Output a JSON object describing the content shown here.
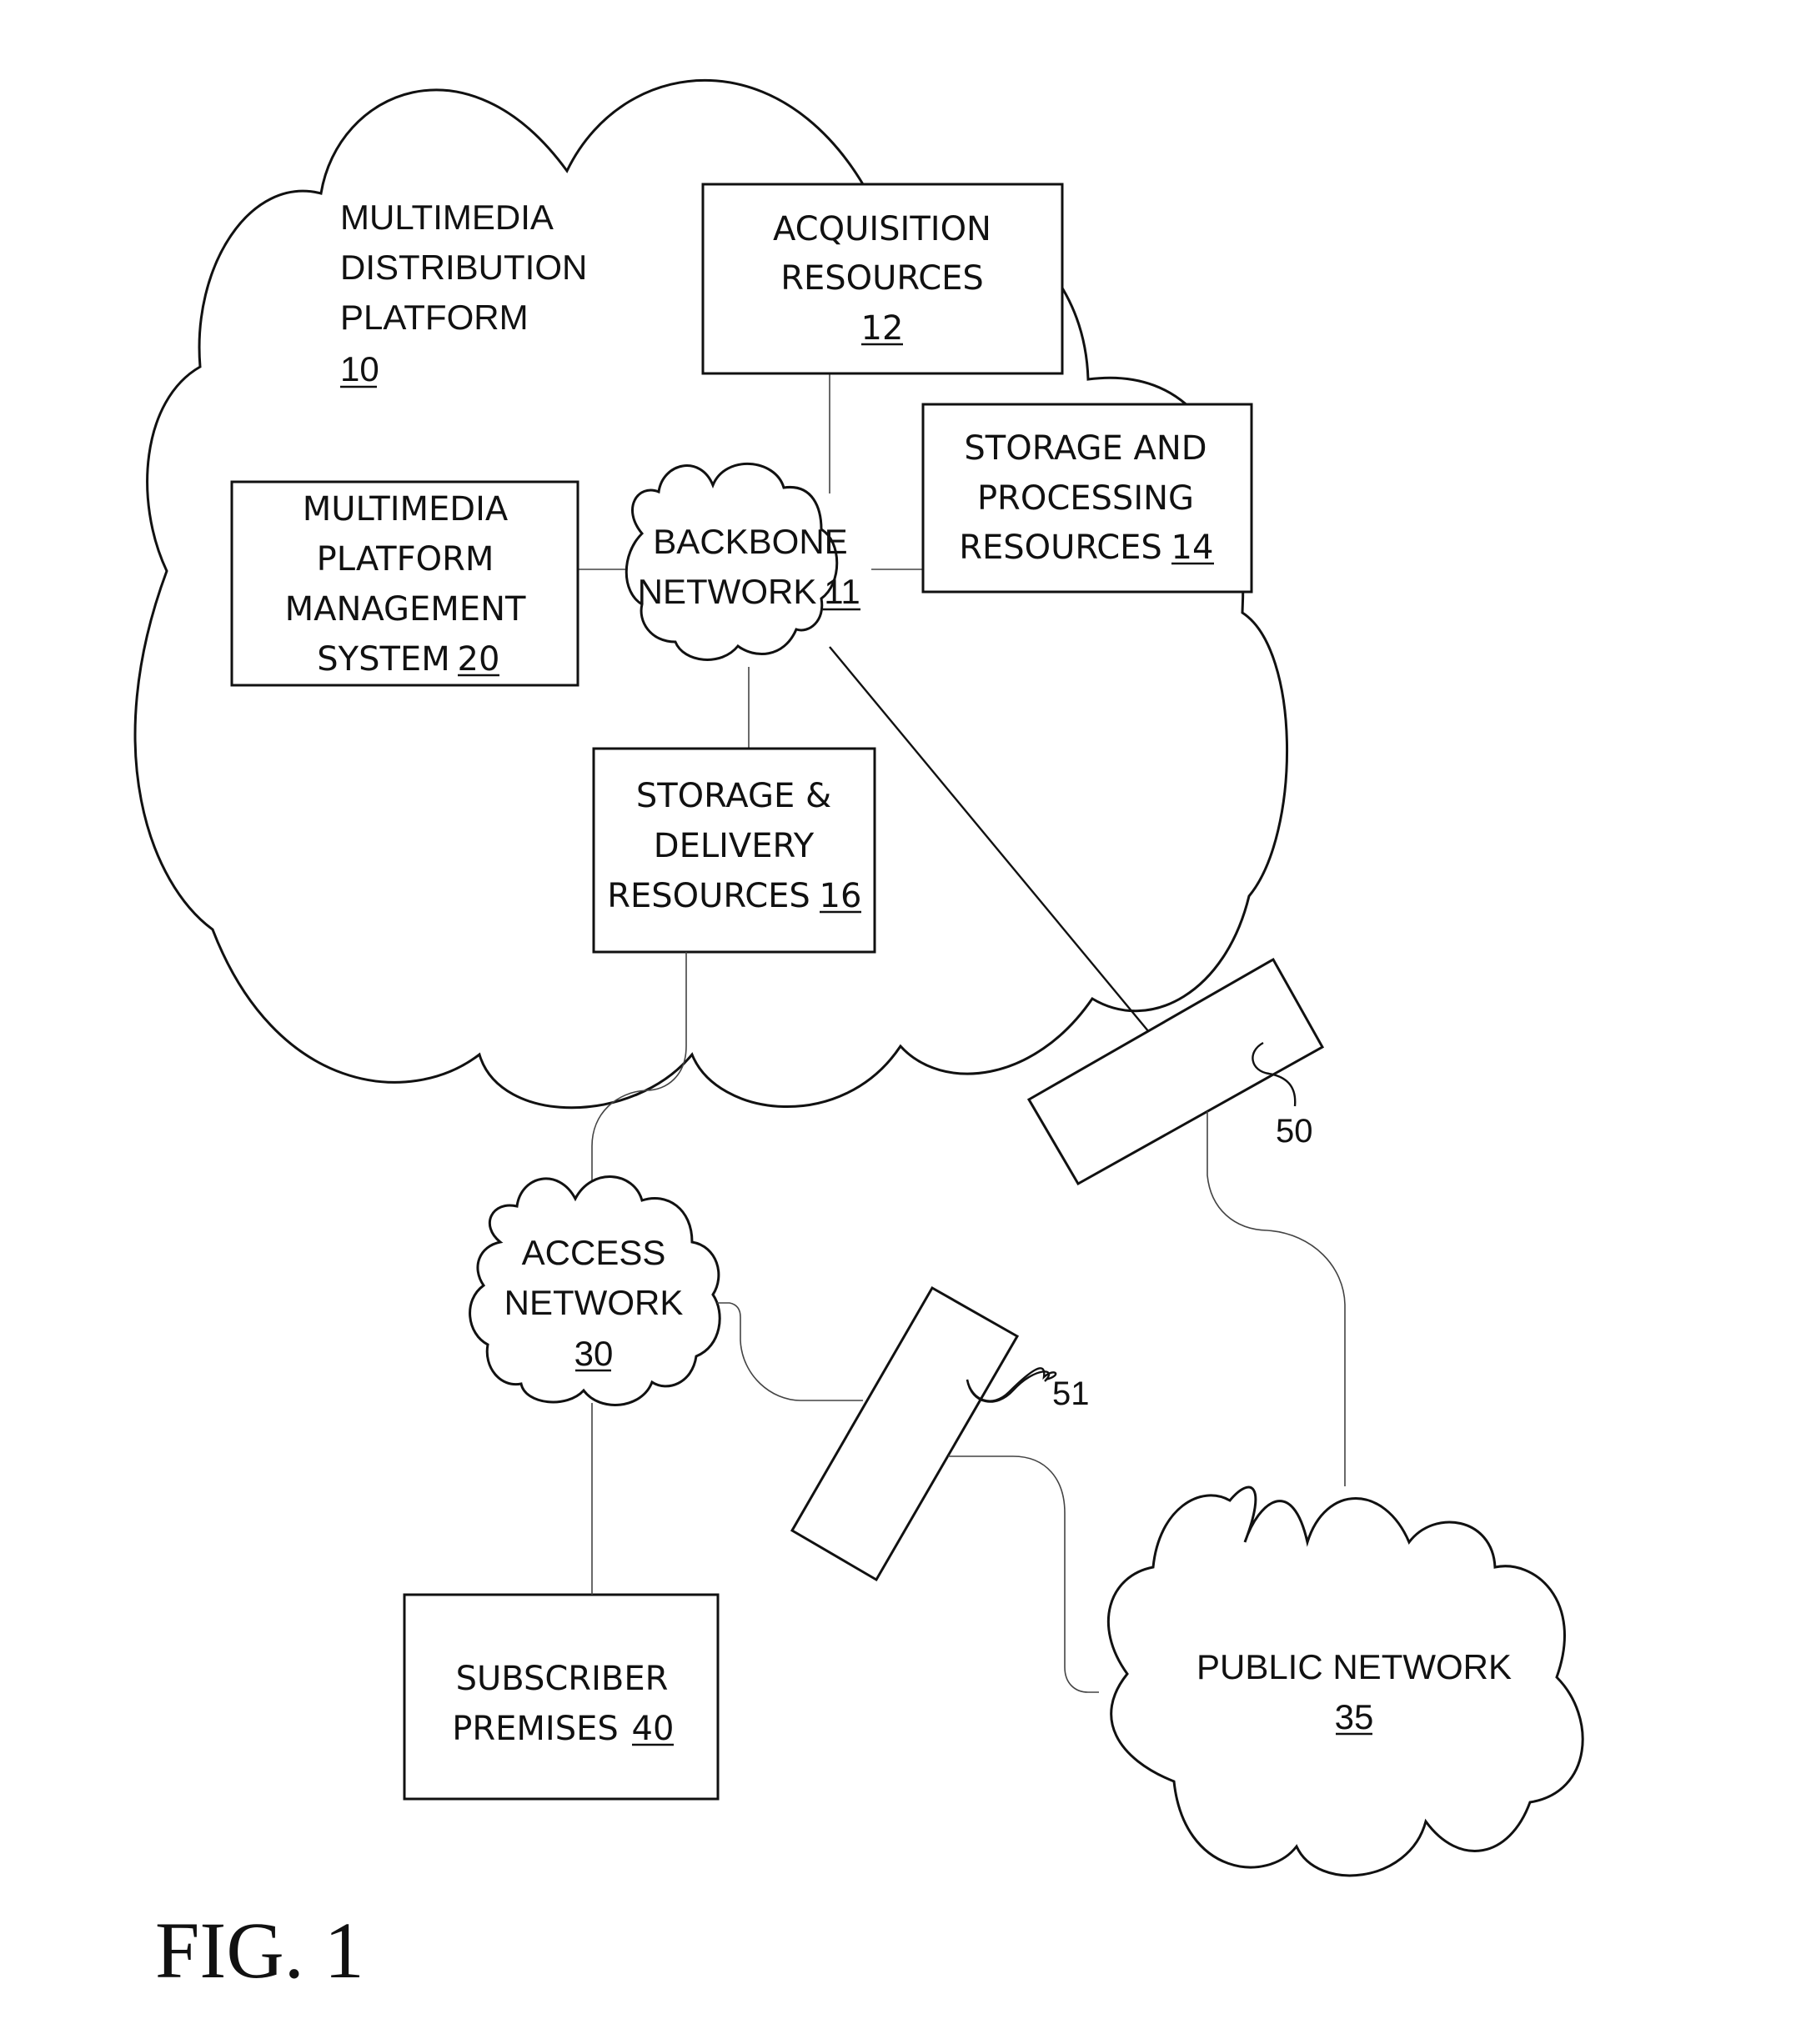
{
  "figure": {
    "label": "FIG. 1"
  },
  "platform": {
    "lines": [
      "MULTIMEDIA",
      "DISTRIBUTION",
      "PLATFORM"
    ],
    "ref": "10"
  },
  "nodes": {
    "backbone": {
      "lines": [
        "BACKBONE",
        "NETWORK"
      ],
      "ref": "11",
      "shape": "cloud"
    },
    "acquisition": {
      "lines": [
        "ACQUISITION",
        "RESOURCES"
      ],
      "ref": "12",
      "shape": "box"
    },
    "storage_processing": {
      "lines": [
        "STORAGE AND",
        "PROCESSING",
        "RESOURCES"
      ],
      "ref": "14",
      "shape": "box"
    },
    "storage_delivery": {
      "lines": [
        "STORAGE &",
        "DELIVERY",
        "RESOURCES"
      ],
      "ref": "16",
      "shape": "box"
    },
    "management": {
      "lines": [
        "MULTIMEDIA",
        "PLATFORM",
        "MANAGEMENT",
        "SYSTEM"
      ],
      "ref": "20",
      "shape": "box"
    },
    "access": {
      "lines": [
        "ACCESS",
        "NETWORK"
      ],
      "ref": "30",
      "shape": "cloud"
    },
    "public": {
      "lines": [
        "PUBLIC NETWORK"
      ],
      "ref": "35",
      "shape": "cloud"
    },
    "subscriber": {
      "lines": [
        "SUBSCRIBER",
        "PREMISES"
      ],
      "ref": "40",
      "shape": "box"
    },
    "device50": {
      "ref": "50",
      "shape": "rotated-box"
    },
    "device51": {
      "ref": "51",
      "shape": "rotated-box"
    }
  },
  "connections": [
    {
      "from": "acquisition",
      "to": "backbone"
    },
    {
      "from": "management",
      "to": "backbone"
    },
    {
      "from": "storage_processing",
      "to": "backbone"
    },
    {
      "from": "storage_delivery",
      "to": "backbone"
    },
    {
      "from": "backbone",
      "to": "device50"
    },
    {
      "from": "storage_delivery",
      "to": "access"
    },
    {
      "from": "device50",
      "to": "public"
    },
    {
      "from": "access",
      "to": "device51"
    },
    {
      "from": "device51",
      "to": "public"
    },
    {
      "from": "access",
      "to": "subscriber"
    }
  ]
}
